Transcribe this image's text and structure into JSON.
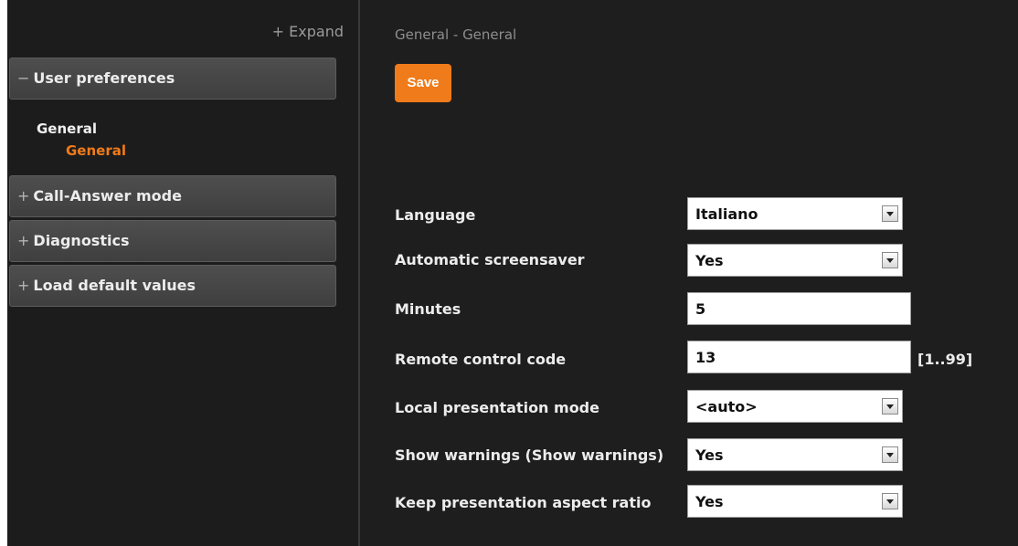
{
  "sidebar": {
    "expand_label": "+ Expand",
    "sections": [
      {
        "sign": "−",
        "label": "User preferences"
      },
      {
        "sign": "+",
        "label": "Call-Answer mode"
      },
      {
        "sign": "+",
        "label": "Diagnostics"
      },
      {
        "sign": "+",
        "label": "Load default values"
      }
    ],
    "tree": {
      "group": "General",
      "item": "General"
    }
  },
  "main": {
    "breadcrumb": "General - General",
    "save_label": "Save",
    "fields": [
      {
        "label": "Language",
        "value": "Italiano",
        "type": "select"
      },
      {
        "label": "Automatic screensaver",
        "value": "Yes",
        "type": "select"
      },
      {
        "label": "Minutes",
        "value": "5",
        "type": "text"
      },
      {
        "label": "Remote control code",
        "value": "13",
        "type": "text",
        "range": "[1..99]"
      },
      {
        "label": "Local presentation mode",
        "value": "<auto>",
        "type": "select"
      },
      {
        "label": "Show warnings (Show warnings)",
        "value": "Yes",
        "type": "select"
      },
      {
        "label": "Keep presentation aspect ratio",
        "value": "Yes",
        "type": "select"
      }
    ]
  },
  "colors": {
    "accent": "#f07b1a",
    "background": "#1e1e1e",
    "panel": "#464646"
  },
  "icons": {
    "dropdown": "dropdown-arrow-icon"
  }
}
